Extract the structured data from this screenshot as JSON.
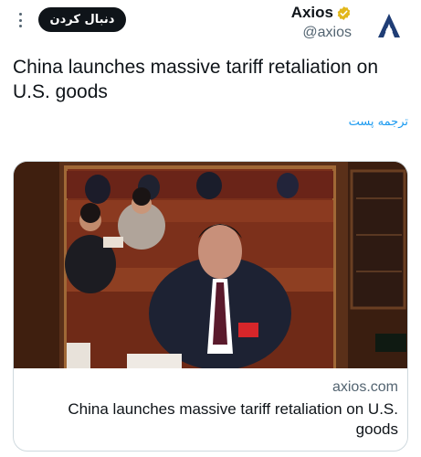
{
  "header": {
    "follow_label": "دنبال کردن",
    "author_name": "Axios",
    "handle": "@axios",
    "verified_color": "#e2b719",
    "avatar_color": "#1f3d75"
  },
  "tweet": {
    "text": "China launches massive tariff retaliation on U.S. goods",
    "translate_label": "ترجمه پست"
  },
  "card": {
    "image_icon": "photo-of-xi-jinping-at-congress",
    "domain": "axios.com",
    "title": "China launches massive tariff retaliation on U.S. goods"
  }
}
